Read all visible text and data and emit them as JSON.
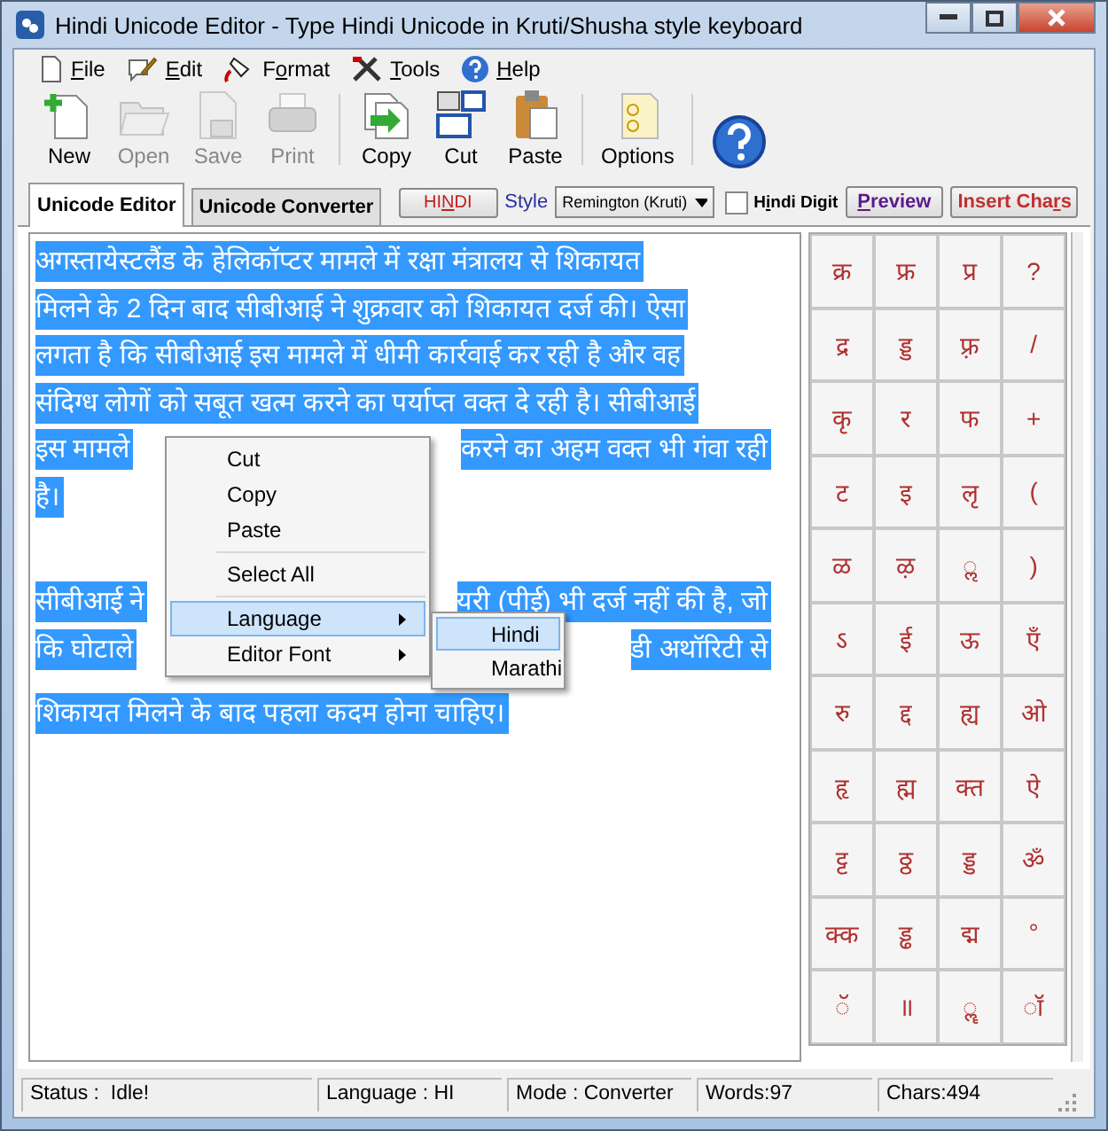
{
  "window": {
    "title": "Hindi Unicode Editor - Type Hindi Unicode in Kruti/Shusha style keyboard"
  },
  "menu": [
    {
      "key": "F",
      "post": "ile"
    },
    {
      "key": "E",
      "post": "dit"
    },
    {
      "pre": "F",
      "key": "o",
      "post": "rmat"
    },
    {
      "key": "T",
      "post": "ools"
    },
    {
      "key": "H",
      "post": "elp"
    }
  ],
  "toolbar": [
    {
      "label": "New",
      "disabled": false
    },
    {
      "label": "Open",
      "disabled": true
    },
    {
      "label": "Save",
      "disabled": true
    },
    {
      "label": "Print",
      "disabled": true
    },
    {
      "label": "Copy",
      "disabled": false
    },
    {
      "label": "Cut",
      "disabled": false
    },
    {
      "label": "Paste",
      "disabled": false
    },
    {
      "label": "Options",
      "disabled": false
    },
    {
      "disabled": false
    }
  ],
  "tabs": [
    {
      "label": "Unicode Editor",
      "selected": true
    },
    {
      "label": "Unicode Converter",
      "selected": false
    }
  ],
  "hindi_button": {
    "pre": "HI",
    "key": "N",
    "post": "DI"
  },
  "style": {
    "label": "Style",
    "value": "Remington (Kruti)"
  },
  "hindi_digit": {
    "pre": "H",
    "key": "i",
    "post": "ndi Digit",
    "checked": false
  },
  "preview_button": {
    "key": "P",
    "post": "review"
  },
  "insert_button": {
    "pre": "Insert Cha",
    "key": "r",
    "post": "s"
  },
  "editor": {
    "selected": true,
    "paragraphs": [
      [
        {
          "left": "अगस्तायेस्टलैंड के हेलिकॉप्टर मामले में रक्षा मंत्रालय से शिकायत"
        },
        {
          "left": "मिलने के 2 दिन बाद सीबीआई ने शुक्रवार को शिकायत दर्ज की। ऐसा"
        },
        {
          "left": "लगता है कि सीबीआई इस मामले में धीमी कार्रवाई कर रही है और वह"
        },
        {
          "left": "संदिग्ध लोगों को सबूत खत्म करने का पर्याप्त वक्त दे रही है। सीबीआई"
        },
        {
          "left": "इस मामले",
          "right": "करने का अहम वक्त भी गंवा रही"
        },
        {
          "left": "है।"
        }
      ],
      [
        {
          "left": "सीबीआई ने",
          "right": "यरी (पीई) भी दर्ज नहीं की है, जो"
        },
        {
          "left": "कि घोटाले",
          "right": "डी अथॉरिटी से"
        },
        {
          "left": "शिकायत मिलने के बाद पहला कदम होना चाहिए।"
        }
      ]
    ]
  },
  "context_menu": [
    {
      "kind": "item",
      "label": "Cut"
    },
    {
      "kind": "item",
      "label": "Copy"
    },
    {
      "kind": "item",
      "label": "Paste"
    },
    {
      "kind": "separator"
    },
    {
      "kind": "item",
      "label": "Select All"
    },
    {
      "kind": "separator"
    },
    {
      "kind": "submenu",
      "label": "Language",
      "selected": true
    },
    {
      "kind": "submenu",
      "label": "Editor Font",
      "selected": false
    }
  ],
  "submenu": [
    {
      "label": "Hindi",
      "selected": true
    },
    {
      "label": "Marathi",
      "selected": false
    }
  ],
  "char_grid": [
    [
      "क्र",
      "फ्र",
      "प्र",
      "?"
    ],
    [
      "द्र",
      "ड्ड",
      "फ़्र",
      "/"
    ],
    [
      "कृ",
      "र",
      "फ",
      "+"
    ],
    [
      "ट",
      "इ",
      "लृ",
      "("
    ],
    [
      "ळ",
      "ऴ",
      "ॢ",
      ")"
    ],
    [
      "ऽ",
      "ई",
      "ऊ",
      "एँ"
    ],
    [
      "रु",
      "द्द",
      "ह्य",
      "ओ"
    ],
    [
      "हृ",
      "ह्म",
      "क्त",
      "ऐ"
    ],
    [
      "ट्ट",
      "ठ्ठ",
      "ड्ड",
      "ॐ"
    ],
    [
      "क्क",
      "ड्ढ",
      "द्म",
      "°"
    ],
    [
      "ॅ",
      "॥",
      "ॣ",
      "ॉ"
    ]
  ],
  "status_bar": [
    "Status :  Idle!",
    "Language : HI",
    "Mode : Converter",
    "Words:97",
    "Chars:494"
  ]
}
